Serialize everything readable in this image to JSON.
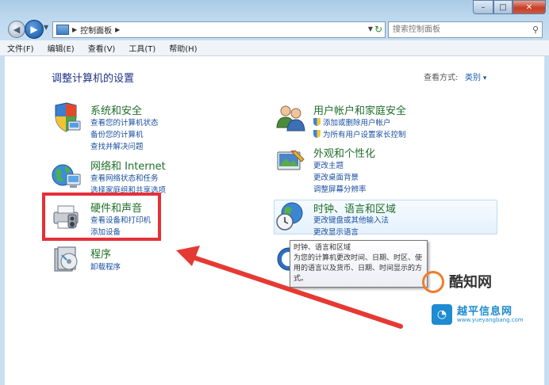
{
  "window": {
    "caption": {
      "minimize": "–",
      "maximize": "□",
      "close": "✕"
    }
  },
  "nav": {
    "breadcrumb": "控制面板",
    "search_placeholder": "搜索控制面板"
  },
  "menu": [
    "文件(F)",
    "编辑(E)",
    "查看(V)",
    "工具(T)",
    "帮助(H)"
  ],
  "content": {
    "title": "调整计算机的设置",
    "view_by_label": "查看方式:",
    "view_by_value": "类别"
  },
  "categories": [
    {
      "id": "system-security",
      "icon": "system-security-icon",
      "title": "系统和安全",
      "links": [
        "查看您的计算机状态",
        "备份您的计算机",
        "查找并解决问题"
      ]
    },
    {
      "id": "network",
      "icon": "network-internet-icon",
      "title": "网络和 Internet",
      "links": [
        "查看网络状态和任务",
        "选择家庭组和共享选项"
      ]
    },
    {
      "id": "hardware-sound",
      "icon": "hardware-sound-icon",
      "title": "硬件和声音",
      "links": [
        "查看设备和打印机",
        "添加设备"
      ]
    },
    {
      "id": "programs",
      "icon": "programs-icon",
      "title": "程序",
      "links": [
        "卸载程序"
      ]
    },
    {
      "id": "user-accounts",
      "icon": "user-accounts-icon",
      "title": "用户帐户和家庭安全",
      "links": [
        "添加或删除用户帐户",
        "为所有用户设置家长控制"
      ]
    },
    {
      "id": "appearance",
      "icon": "appearance-icon",
      "title": "外观和个性化",
      "links": [
        "更改主题",
        "更改桌面背景",
        "调整屏幕分辨率"
      ]
    },
    {
      "id": "clock-region",
      "icon": "clock-globe-icon",
      "title": "时钟、语言和区域",
      "links": [
        "更改键盘或其他输入法",
        "更改显示语言"
      ]
    }
  ],
  "tooltip": {
    "title": "时钟、语言和区域",
    "body": "为您的计算机更改时间、日期、时区、使用的语言以及货币、日期、时间显示的方式。"
  },
  "watermarks": {
    "brand1": "酷知网",
    "brand2": "越平信息网",
    "brand2_url": "www.yueyangbang.com"
  },
  "colors": {
    "highlight": "#e5303a",
    "link": "#1b4fa0",
    "category_title": "#1f6f29"
  }
}
